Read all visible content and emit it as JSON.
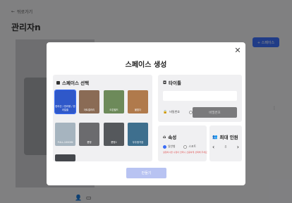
{
  "background": {
    "back_label": "뒤로가기",
    "page_title": "관리자n",
    "add_button_label": "+ 스페이스"
  },
  "modal": {
    "title": "스페이스 생성",
    "space_section": {
      "heading": "스페이스 선택",
      "tiles": [
        {
          "label": "한라산 / 한라봉 / 한라일출",
          "color": "#2f58c9",
          "selected": true
        },
        {
          "label": "아트갤러리",
          "color": "#8a6b55"
        },
        {
          "label": "오픈필드",
          "color": "#6d8a5a"
        },
        {
          "label": "불빛다",
          "color": "#b07a4c"
        },
        {
          "label": "FULL-1000Ml",
          "color": "#a6b4bf"
        },
        {
          "label": "룸형",
          "color": "#6b6b6e"
        },
        {
          "label": "룸형2",
          "color": "#55585c"
        },
        {
          "label": "우주정거장",
          "color": "#3e6f8e"
        },
        {
          "label": "",
          "color": "#44474c"
        }
      ]
    },
    "title_section": {
      "heading": "타이틀",
      "input_value": "",
      "private_label": "비밀번호",
      "password_placeholder": "비밀번호"
    },
    "attr_section": {
      "heading": "속성",
      "options": [
        "일반형",
        "스포트"
      ],
      "warning": "설정하시면 수정이 안되니 신중하게 선택해 주세요"
    },
    "max_section": {
      "heading": "최대 인원",
      "value": "8"
    },
    "create_button": "만들기"
  }
}
